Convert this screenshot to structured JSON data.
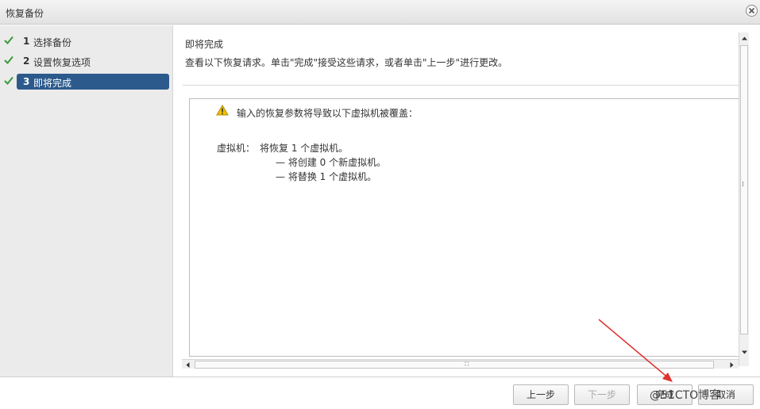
{
  "window": {
    "title": "恢复备份"
  },
  "sidebar": {
    "steps": [
      {
        "num": "1",
        "label": "选择备份",
        "done": true,
        "active": false
      },
      {
        "num": "2",
        "label": "设置恢复选项",
        "done": true,
        "active": false
      },
      {
        "num": "3",
        "label": "即将完成",
        "done": true,
        "active": true
      }
    ]
  },
  "main": {
    "title": "即将完成",
    "description": "查看以下恢复请求。单击\"完成\"接受这些请求，或者单击\"上一步\"进行更改。",
    "warning": "输入的恢复参数将导致以下虚拟机被覆盖：",
    "vm_label": "虚拟机：",
    "vm_lines": [
      "将恢复 1 个虚拟机。",
      "— 将创建 0 个新虚拟机。",
      "— 将替换 1 个虚拟机。"
    ]
  },
  "footer": {
    "back_label": "上一步",
    "next_label": "下一步",
    "finish_label": "完成",
    "cancel_label": "取消"
  },
  "watermark": "@51CTO博客",
  "colors": {
    "active_step": "#2c5a8c",
    "check": "#3a9a3a",
    "annotation": "#e03030",
    "warning": "#f2c200"
  },
  "icons": [
    "check-icon",
    "warning-icon",
    "close-icon",
    "scroll-up-icon",
    "scroll-down-icon",
    "scroll-left-icon",
    "scroll-right-icon"
  ]
}
